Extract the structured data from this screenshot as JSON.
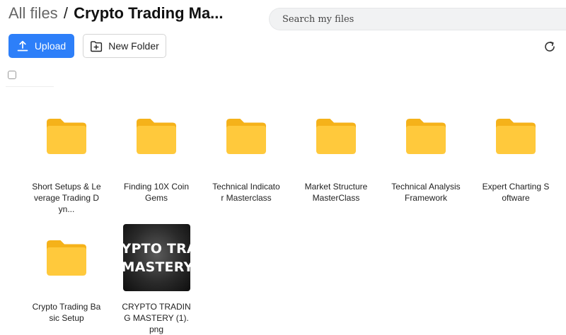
{
  "breadcrumb": {
    "root": "All files",
    "separator": "/",
    "current": "Crypto Trading Ma..."
  },
  "search": {
    "placeholder": "Search my files"
  },
  "toolbar": {
    "upload_label": "Upload",
    "new_folder_label": "New Folder",
    "upload_icon": "upload-icon",
    "new_folder_icon": "add-folder-icon",
    "refresh_icon": "refresh-icon"
  },
  "colors": {
    "accent": "#2d7ff9",
    "folder": "#ffc93c",
    "folder_back": "#f5b21a"
  },
  "items": [
    {
      "type": "folder",
      "label": "Short Setups & Leverage Trading Dyn..."
    },
    {
      "type": "folder",
      "label": "Finding 10X Coin Gems"
    },
    {
      "type": "folder",
      "label": "Technical Indicator Masterclass"
    },
    {
      "type": "folder",
      "label": "Market Structure MasterClass"
    },
    {
      "type": "folder",
      "label": "Technical Analysis Framework"
    },
    {
      "type": "folder",
      "label": "Expert Charting Software"
    },
    {
      "type": "folder",
      "label": "Crypto Trading Basic Setup"
    },
    {
      "type": "file",
      "label": "CRYPTO TRADING MASTERY (1).png",
      "thumb_text": [
        "YPTO TRAD",
        "MASTERY"
      ]
    }
  ]
}
